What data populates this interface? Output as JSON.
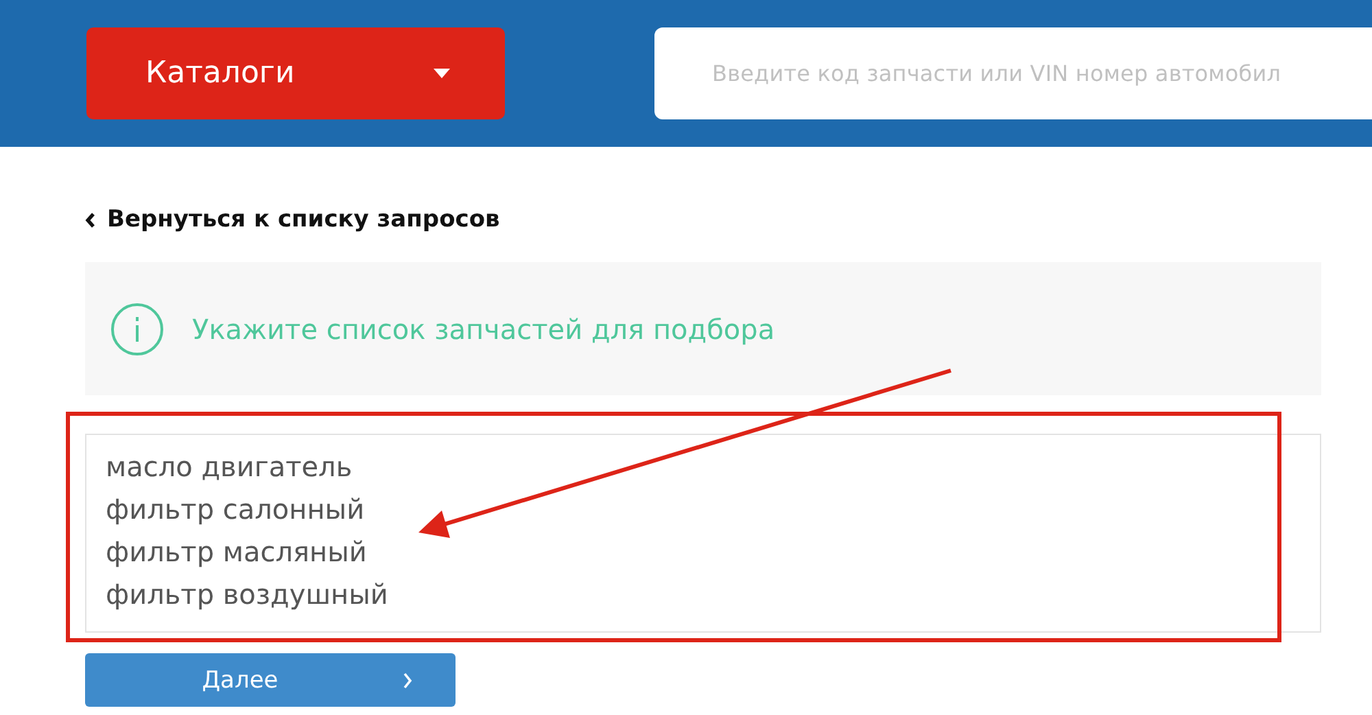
{
  "header": {
    "catalog_button": {
      "label": "Каталоги"
    },
    "search": {
      "placeholder": "Введите код запчасти или VIN номер автомобил"
    }
  },
  "back_link": {
    "label": "Вернуться к списку запросов"
  },
  "info": {
    "message": "Укажите список запчастей для подбора"
  },
  "parts_list": {
    "lines": [
      "масло двигатель",
      "фильтр салонный",
      "фильтр масляный",
      "фильтр воздушный"
    ]
  },
  "next_button": {
    "label": "Далее"
  }
}
